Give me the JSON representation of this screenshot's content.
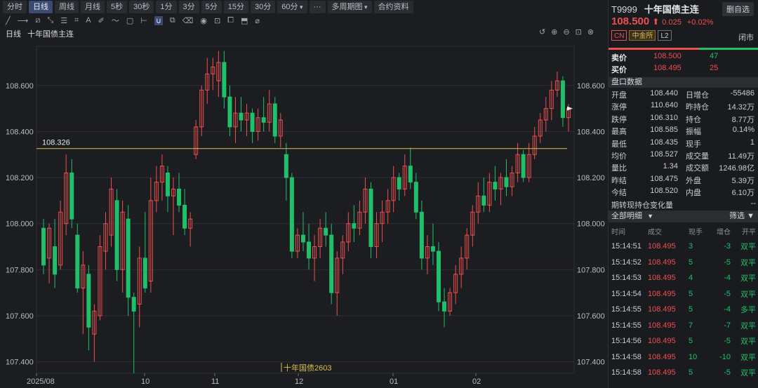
{
  "toolbar": {
    "periods": [
      {
        "label": "分时",
        "active": false
      },
      {
        "label": "日线",
        "active": true
      },
      {
        "label": "周线",
        "active": false
      },
      {
        "label": "月线",
        "active": false
      },
      {
        "label": "5秒",
        "active": false
      },
      {
        "label": "30秒",
        "active": false
      },
      {
        "label": "1分",
        "active": false
      },
      {
        "label": "3分",
        "active": false
      },
      {
        "label": "5分",
        "active": false
      },
      {
        "label": "15分",
        "active": false
      },
      {
        "label": "30分",
        "active": false
      },
      {
        "label": "60分",
        "active": false
      }
    ],
    "more": "···",
    "multi_period": "多周期图",
    "contract_info": "合约资料"
  },
  "chart": {
    "period_label": "日线",
    "name": "十年国债主连",
    "ref_line_value": 108.326,
    "y_ticks": [
      "108.600",
      "108.400",
      "108.200",
      "108.000",
      "107.800",
      "107.600",
      "107.400"
    ],
    "x_ticks": [
      "2025/08",
      "10",
      "11",
      "12",
      "01",
      "02"
    ],
    "contract_marker": "十年国债2603",
    "colors": {
      "up": "#ee4f4f",
      "down": "#20c06a",
      "ref": "#d9c24a",
      "grid": "#2c2e33"
    }
  },
  "chart_data": {
    "type": "candlestick",
    "ylim": [
      107.35,
      108.77
    ],
    "y_ticks": [
      107.4,
      107.6,
      107.8,
      108.0,
      108.2,
      108.4,
      108.6
    ],
    "x_ticks": [
      "2025/08",
      "10",
      "11",
      "12",
      "01",
      "02"
    ],
    "hline": 108.326,
    "candles": [
      {
        "o": 107.98,
        "h": 108.02,
        "l": 107.78,
        "c": 107.82
      },
      {
        "o": 107.85,
        "h": 108.0,
        "l": 107.74,
        "c": 107.98
      },
      {
        "o": 107.9,
        "h": 108.02,
        "l": 107.72,
        "c": 107.78
      },
      {
        "o": 107.82,
        "h": 108.1,
        "l": 107.8,
        "c": 108.05
      },
      {
        "o": 108.0,
        "h": 108.3,
        "l": 107.95,
        "c": 108.22
      },
      {
        "o": 108.22,
        "h": 108.28,
        "l": 107.98,
        "c": 108.02
      },
      {
        "o": 107.95,
        "h": 108.0,
        "l": 107.7,
        "c": 107.72
      },
      {
        "o": 107.72,
        "h": 107.88,
        "l": 107.52,
        "c": 107.82
      },
      {
        "o": 107.78,
        "h": 107.82,
        "l": 107.45,
        "c": 107.55
      },
      {
        "o": 107.52,
        "h": 107.65,
        "l": 107.4,
        "c": 107.62
      },
      {
        "o": 107.6,
        "h": 107.95,
        "l": 107.58,
        "c": 107.9
      },
      {
        "o": 107.88,
        "h": 108.05,
        "l": 107.8,
        "c": 108.0
      },
      {
        "o": 107.95,
        "h": 108.2,
        "l": 107.9,
        "c": 108.15
      },
      {
        "o": 108.1,
        "h": 108.15,
        "l": 107.75,
        "c": 107.8
      },
      {
        "o": 107.8,
        "h": 108.1,
        "l": 107.7,
        "c": 108.05
      },
      {
        "o": 108.02,
        "h": 108.08,
        "l": 107.6,
        "c": 107.68
      },
      {
        "o": 107.68,
        "h": 107.7,
        "l": 107.35,
        "c": 107.62
      },
      {
        "o": 107.65,
        "h": 107.9,
        "l": 107.55,
        "c": 107.85
      },
      {
        "o": 107.85,
        "h": 108.05,
        "l": 107.7,
        "c": 107.72
      },
      {
        "o": 107.75,
        "h": 108.2,
        "l": 107.7,
        "c": 108.1
      },
      {
        "o": 108.1,
        "h": 108.25,
        "l": 108.05,
        "c": 108.18
      },
      {
        "o": 108.18,
        "h": 108.3,
        "l": 108.1,
        "c": 108.25
      },
      {
        "o": 108.22,
        "h": 108.25,
        "l": 108.05,
        "c": 108.12
      },
      {
        "o": 108.12,
        "h": 108.2,
        "l": 107.95,
        "c": 108.15
      },
      {
        "o": 108.15,
        "h": 108.22,
        "l": 108.05,
        "c": 108.08
      },
      {
        "o": 108.08,
        "h": 108.15,
        "l": 107.95,
        "c": 107.98
      },
      {
        "o": 107.98,
        "h": 108.05,
        "l": 107.9,
        "c": 108.02
      },
      {
        "o": 108.3,
        "h": 108.45,
        "l": 108.28,
        "c": 108.42
      },
      {
        "o": 108.42,
        "h": 108.6,
        "l": 108.38,
        "c": 108.58
      },
      {
        "o": 108.58,
        "h": 108.72,
        "l": 108.52,
        "c": 108.65
      },
      {
        "o": 108.65,
        "h": 108.72,
        "l": 108.58,
        "c": 108.68
      },
      {
        "o": 108.62,
        "h": 108.75,
        "l": 108.55,
        "c": 108.7
      },
      {
        "o": 108.7,
        "h": 108.75,
        "l": 108.5,
        "c": 108.55
      },
      {
        "o": 108.55,
        "h": 108.6,
        "l": 108.38,
        "c": 108.42
      },
      {
        "o": 108.42,
        "h": 108.55,
        "l": 108.35,
        "c": 108.48
      },
      {
        "o": 108.48,
        "h": 108.55,
        "l": 108.4,
        "c": 108.45
      },
      {
        "o": 108.45,
        "h": 108.52,
        "l": 108.38,
        "c": 108.48
      },
      {
        "o": 108.48,
        "h": 108.5,
        "l": 108.35,
        "c": 108.4
      },
      {
        "o": 108.4,
        "h": 108.5,
        "l": 108.36,
        "c": 108.46
      },
      {
        "o": 108.46,
        "h": 108.55,
        "l": 108.4,
        "c": 108.44
      },
      {
        "o": 108.44,
        "h": 108.58,
        "l": 108.4,
        "c": 108.52
      },
      {
        "o": 108.52,
        "h": 108.55,
        "l": 108.35,
        "c": 108.38
      },
      {
        "o": 108.38,
        "h": 108.48,
        "l": 108.33,
        "c": 108.45
      },
      {
        "o": 108.3,
        "h": 108.35,
        "l": 108.1,
        "c": 108.2
      },
      {
        "o": 108.2,
        "h": 108.22,
        "l": 107.85,
        "c": 107.88
      },
      {
        "o": 107.88,
        "h": 107.98,
        "l": 107.85,
        "c": 107.95
      },
      {
        "o": 107.95,
        "h": 108.05,
        "l": 107.88,
        "c": 107.92
      },
      {
        "o": 107.92,
        "h": 108.0,
        "l": 107.8,
        "c": 107.85
      },
      {
        "o": 107.85,
        "h": 107.95,
        "l": 107.75,
        "c": 107.9
      },
      {
        "o": 107.9,
        "h": 108.02,
        "l": 107.85,
        "c": 107.98
      },
      {
        "o": 107.98,
        "h": 108.05,
        "l": 107.9,
        "c": 107.95
      },
      {
        "o": 107.95,
        "h": 108.0,
        "l": 107.65,
        "c": 107.7
      },
      {
        "o": 107.7,
        "h": 107.88,
        "l": 107.6,
        "c": 107.85
      },
      {
        "o": 107.85,
        "h": 107.95,
        "l": 107.78,
        "c": 107.92
      },
      {
        "o": 107.92,
        "h": 108.05,
        "l": 107.88,
        "c": 108.0
      },
      {
        "o": 108.0,
        "h": 108.08,
        "l": 107.92,
        "c": 107.98
      },
      {
        "o": 107.98,
        "h": 108.1,
        "l": 107.95,
        "c": 108.05
      },
      {
        "o": 108.05,
        "h": 108.2,
        "l": 108.0,
        "c": 108.15
      },
      {
        "o": 108.15,
        "h": 108.18,
        "l": 107.85,
        "c": 107.9
      },
      {
        "o": 107.9,
        "h": 108.05,
        "l": 107.85,
        "c": 108.0
      },
      {
        "o": 108.0,
        "h": 108.1,
        "l": 107.92,
        "c": 108.05
      },
      {
        "o": 108.05,
        "h": 108.15,
        "l": 108.0,
        "c": 108.1
      },
      {
        "o": 108.1,
        "h": 108.25,
        "l": 108.05,
        "c": 108.2
      },
      {
        "o": 108.2,
        "h": 108.22,
        "l": 108.1,
        "c": 108.15
      },
      {
        "o": 108.15,
        "h": 108.3,
        "l": 108.12,
        "c": 108.25
      },
      {
        "o": 108.25,
        "h": 108.33,
        "l": 108.15,
        "c": 108.18
      },
      {
        "o": 108.18,
        "h": 108.22,
        "l": 108.02,
        "c": 108.05
      },
      {
        "o": 108.05,
        "h": 108.1,
        "l": 107.8,
        "c": 107.85
      },
      {
        "o": 107.85,
        "h": 107.95,
        "l": 107.78,
        "c": 107.9
      },
      {
        "o": 107.9,
        "h": 108.0,
        "l": 107.82,
        "c": 107.88
      },
      {
        "o": 107.88,
        "h": 107.92,
        "l": 107.62,
        "c": 107.66
      },
      {
        "o": 107.66,
        "h": 107.72,
        "l": 107.55,
        "c": 107.62
      },
      {
        "o": 107.62,
        "h": 107.72,
        "l": 107.6,
        "c": 107.7
      },
      {
        "o": 107.7,
        "h": 107.82,
        "l": 107.65,
        "c": 107.78
      },
      {
        "o": 107.78,
        "h": 107.9,
        "l": 107.72,
        "c": 107.85
      },
      {
        "o": 107.85,
        "h": 107.98,
        "l": 107.8,
        "c": 107.95
      },
      {
        "o": 107.95,
        "h": 108.08,
        "l": 107.9,
        "c": 108.05
      },
      {
        "o": 108.05,
        "h": 108.18,
        "l": 108.0,
        "c": 108.12
      },
      {
        "o": 108.12,
        "h": 108.2,
        "l": 108.05,
        "c": 108.08
      },
      {
        "o": 108.08,
        "h": 108.22,
        "l": 108.05,
        "c": 108.18
      },
      {
        "o": 108.18,
        "h": 108.25,
        "l": 108.1,
        "c": 108.15
      },
      {
        "o": 108.15,
        "h": 108.22,
        "l": 108.08,
        "c": 108.2
      },
      {
        "o": 108.2,
        "h": 108.28,
        "l": 108.12,
        "c": 108.16
      },
      {
        "o": 108.16,
        "h": 108.25,
        "l": 108.12,
        "c": 108.22
      },
      {
        "o": 108.22,
        "h": 108.35,
        "l": 108.18,
        "c": 108.3
      },
      {
        "o": 108.3,
        "h": 108.32,
        "l": 108.18,
        "c": 108.2
      },
      {
        "o": 108.2,
        "h": 108.35,
        "l": 108.18,
        "c": 108.3
      },
      {
        "o": 108.3,
        "h": 108.42,
        "l": 108.28,
        "c": 108.38
      },
      {
        "o": 108.38,
        "h": 108.48,
        "l": 108.35,
        "c": 108.45
      },
      {
        "o": 108.45,
        "h": 108.55,
        "l": 108.4,
        "c": 108.5
      },
      {
        "o": 108.5,
        "h": 108.62,
        "l": 108.45,
        "c": 108.58
      },
      {
        "o": 108.58,
        "h": 108.66,
        "l": 108.55,
        "c": 108.62
      },
      {
        "o": 108.62,
        "h": 108.64,
        "l": 108.42,
        "c": 108.46
      },
      {
        "o": 108.46,
        "h": 108.52,
        "l": 108.4,
        "c": 108.5
      }
    ]
  },
  "panel": {
    "code": "T9999",
    "name": "十年国债主连",
    "delete_btn": "删自选",
    "price": "108.500",
    "arrow": "⬆",
    "change": "0.025",
    "change_pct": "+0.02%",
    "tags": {
      "cn": "CN",
      "exchange": "中金所",
      "level": "L2"
    },
    "status": "闭市",
    "ask": {
      "label": "卖价",
      "price": "108.500",
      "vol": "47"
    },
    "bid": {
      "label": "买价",
      "price": "108.495",
      "vol": "25"
    },
    "section_title": "盘口数据",
    "stats": [
      {
        "k1": "开盘",
        "v1": "108.440",
        "c1": "green",
        "k2": "日增仓",
        "v2": "-55486",
        "c2": "green"
      },
      {
        "k1": "涨停",
        "v1": "110.640",
        "c1": "red",
        "k2": "昨持仓",
        "v2": "14.32万",
        "c2": "plain"
      },
      {
        "k1": "跌停",
        "v1": "106.310",
        "c1": "green",
        "k2": "持仓",
        "v2": "8.77万",
        "c2": "plain"
      },
      {
        "k1": "最高",
        "v1": "108.585",
        "c1": "red",
        "k2": "振幅",
        "v2": "0.14%",
        "c2": "plain"
      },
      {
        "k1": "最低",
        "v1": "108.435",
        "c1": "green",
        "k2": "现手",
        "v2": "1",
        "c2": "plain"
      },
      {
        "k1": "均价",
        "v1": "108.527",
        "c1": "red",
        "k2": "成交量",
        "v2": "11.49万",
        "c2": "plain"
      },
      {
        "k1": "量比",
        "v1": "1.34",
        "c1": "plain",
        "k2": "成交额",
        "v2": "1246.98亿",
        "c2": "plain"
      },
      {
        "k1": "昨结",
        "v1": "108.475",
        "c1": "plain",
        "k2": "外盘",
        "v2": "5.39万",
        "c2": "red"
      },
      {
        "k1": "今结",
        "v1": "108.520",
        "c1": "red",
        "k2": "内盘",
        "v2": "6.10万",
        "c2": "green"
      }
    ],
    "oi_change_label": "期转现持仓变化量",
    "oi_change_value": "--",
    "details_tab": "全部明细",
    "filter": "筛选",
    "trade_headers": [
      "时间",
      "成交",
      "现手",
      "增仓",
      "开平"
    ],
    "trades": [
      {
        "time": "15:14:51",
        "price": "108.495",
        "vol": "3",
        "oi": "-3",
        "type": "双平"
      },
      {
        "time": "15:14:52",
        "price": "108.495",
        "vol": "5",
        "oi": "-5",
        "type": "双平"
      },
      {
        "time": "15:14:53",
        "price": "108.495",
        "vol": "4",
        "oi": "-4",
        "type": "双平"
      },
      {
        "time": "15:14:54",
        "price": "108.495",
        "vol": "5",
        "oi": "-5",
        "type": "双平"
      },
      {
        "time": "15:14:55",
        "price": "108.495",
        "vol": "5",
        "oi": "-4",
        "type": "多平"
      },
      {
        "time": "15:14:55",
        "price": "108.495",
        "vol": "7",
        "oi": "-7",
        "type": "双平"
      },
      {
        "time": "15:14:56",
        "price": "108.495",
        "vol": "5",
        "oi": "-5",
        "type": "双平"
      },
      {
        "time": "15:14:58",
        "price": "108.495",
        "vol": "10",
        "oi": "-10",
        "type": "双平"
      },
      {
        "time": "15:14:58",
        "price": "108.495",
        "vol": "5",
        "oi": "-5",
        "type": "双平"
      }
    ]
  }
}
